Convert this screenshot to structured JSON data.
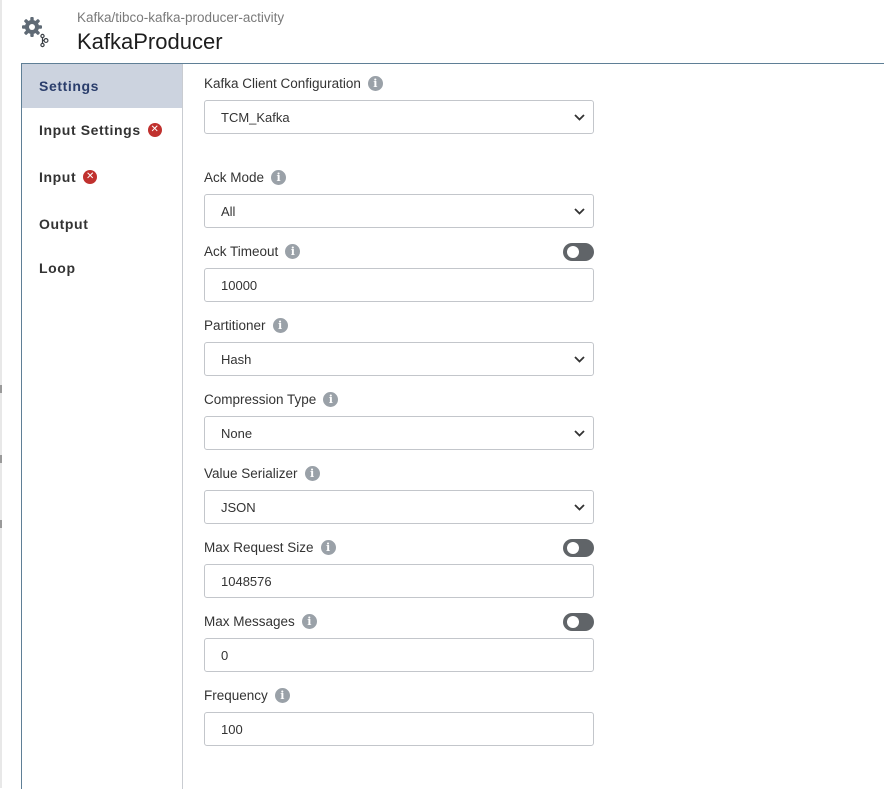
{
  "header": {
    "breadcrumb": "Kafka/tibco-kafka-producer-activity",
    "title": "KafkaProducer",
    "icon": "gear-kafka-icon"
  },
  "sidebar": {
    "items": [
      {
        "label": "Settings",
        "active": true,
        "error": false
      },
      {
        "label": "Input Settings",
        "active": false,
        "error": true
      },
      {
        "label": "Input",
        "active": false,
        "error": true
      },
      {
        "label": "Output",
        "active": false,
        "error": false
      },
      {
        "label": "Loop",
        "active": false,
        "error": false
      }
    ]
  },
  "settings": {
    "client_config": {
      "label": "Kafka Client Configuration",
      "value": "TCM_Kafka"
    },
    "ack_mode": {
      "label": "Ack Mode",
      "value": "All"
    },
    "ack_timeout": {
      "label": "Ack Timeout",
      "value": "10000"
    },
    "partitioner": {
      "label": "Partitioner",
      "value": "Hash"
    },
    "compression_type": {
      "label": "Compression Type",
      "value": "None"
    },
    "value_serializer": {
      "label": "Value Serializer",
      "value": "JSON"
    },
    "max_request_size": {
      "label": "Max Request Size",
      "value": "1048576"
    },
    "max_messages": {
      "label": "Max Messages",
      "value": "0"
    },
    "frequency": {
      "label": "Frequency",
      "value": "100"
    }
  },
  "colors": {
    "active_nav_bg": "#ccd3df",
    "error": "#c0312e",
    "toggle_off": "#606468",
    "panel_border": "#5f7f96"
  }
}
